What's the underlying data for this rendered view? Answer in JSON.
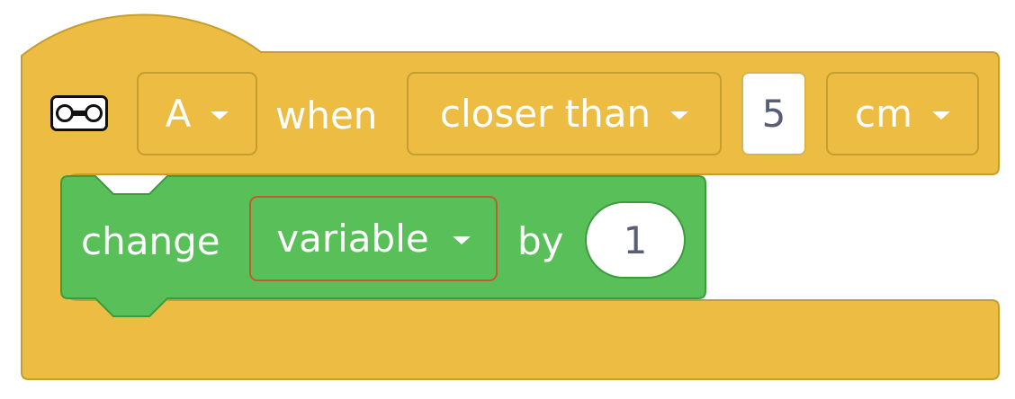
{
  "event_block": {
    "sensor_icon": "distance-sensor-icon",
    "port": {
      "selected": "A"
    },
    "when_label": "when",
    "comparison": {
      "selected": "closer than"
    },
    "distance_value": "5",
    "unit": {
      "selected": "cm"
    },
    "color": "#ecbd42",
    "border_color": "#c69d2f"
  },
  "change_block": {
    "change_label": "change",
    "variable": {
      "selected": "variable"
    },
    "by_label": "by",
    "amount": "1",
    "color": "#59c059",
    "border_color": "#3d9b3d",
    "dropdown_border_color": "#c55a2f"
  }
}
